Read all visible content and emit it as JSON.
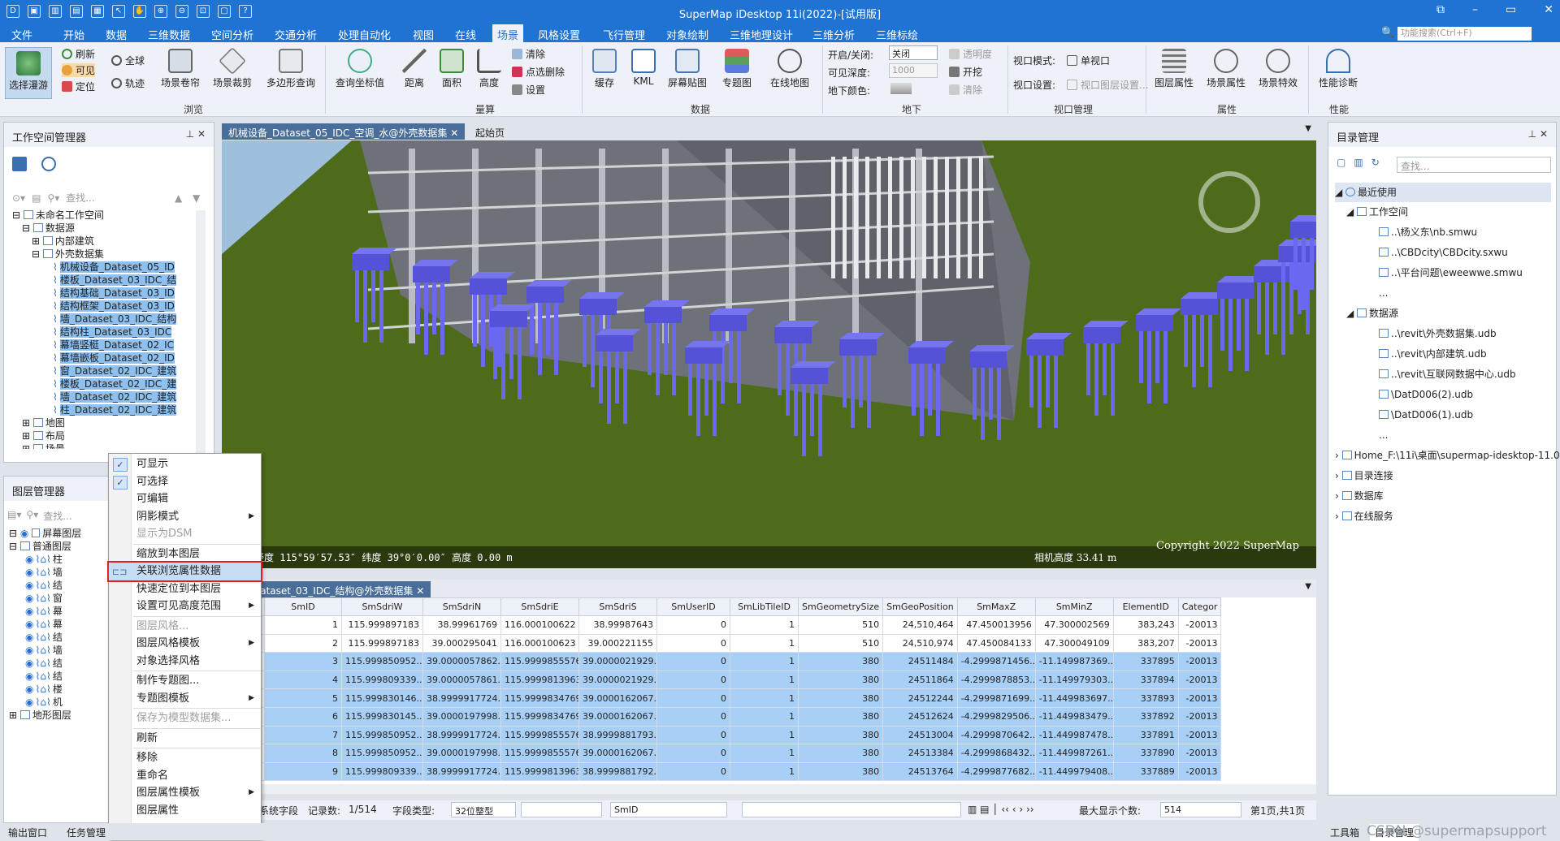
{
  "app": {
    "title": "SuperMap iDesktop 11i(2022)-[试用版]",
    "quick_access": [
      "D",
      "▣",
      "▥",
      "▤",
      "▦",
      "↖",
      "✋",
      "⊕",
      "⊖",
      "⊡",
      "▢",
      "?"
    ],
    "window_controls": [
      "⧉",
      "–",
      "▭",
      "✕"
    ],
    "watermark": "CSDN @supermapsupport"
  },
  "menu": {
    "items": [
      "文件",
      "开始",
      "数据",
      "三维数据",
      "空间分析",
      "交通分析",
      "处理自动化",
      "视图",
      "在线",
      "场景",
      "风格设置",
      "飞行管理",
      "对象绘制",
      "三维地理设计",
      "三维分析",
      "三维标绘"
    ],
    "selected": "场景",
    "search_placeholder": "功能搜索(Ctrl+F)",
    "search_icon": "🔍"
  },
  "ribbon": {
    "browse": {
      "big": "选择漫游",
      "small": [
        "刷新",
        "可见",
        "定位"
      ],
      "small2": [
        "全球",
        "轨迹"
      ],
      "buttons": [
        "场景卷帘",
        "场景裁剪",
        "多边形查询"
      ],
      "group": "浏览"
    },
    "measure": {
      "buttons": [
        "查询坐标值",
        "距离",
        "面积",
        "高度"
      ],
      "small": [
        "清除",
        "点选删除",
        "设置"
      ],
      "group": "量算"
    },
    "data": {
      "buttons": [
        "缓存",
        "KML",
        "屏幕贴图",
        "专题图",
        "在线地图"
      ],
      "group": "数据"
    },
    "underground": {
      "labels": [
        "开启/关闭:",
        "可见深度:",
        "地下颜色:"
      ],
      "toggle_value": "关闭",
      "depth_value": "1000",
      "small": [
        "透明度",
        "开挖",
        "清除"
      ],
      "group": "地下"
    },
    "viewport": {
      "labels": [
        "视口模式:",
        "视口设置:"
      ],
      "mode_value": "单视口",
      "settings_value": "视口图层设置...",
      "group": "视口管理"
    },
    "attr": {
      "buttons": [
        "图层属性",
        "场景属性",
        "场景特效"
      ],
      "group": "属性"
    },
    "perf": {
      "buttons": [
        "性能诊断"
      ],
      "group": "性能"
    }
  },
  "workspace": {
    "title": "工作空间管理器",
    "search_placeholder": "查找...",
    "root": "未命名工作空间",
    "datasource_node": "数据源",
    "ds_children": [
      "内部建筑",
      "外壳数据集"
    ],
    "datasets": [
      "机械设备_Dataset_05_ID",
      "楼板_Dataset_03_IDC_结",
      "结构基础_Dataset_03_ID",
      "结构框架_Dataset_03_ID",
      "墙_Dataset_03_IDC_结构",
      "结构柱_Dataset_03_IDC",
      "幕墙竖梃_Dataset_02_IC",
      "幕墙嵌板_Dataset_02_ID",
      "窗_Dataset_02_IDC_建筑",
      "楼板_Dataset_02_IDC_建",
      "墙_Dataset_02_IDC_建筑",
      "柱_Dataset_02_IDC_建筑"
    ],
    "others": [
      "地图",
      "布局",
      "场景"
    ]
  },
  "layers": {
    "title": "图层管理器",
    "search_placeholder": "查找...",
    "nodes": [
      "屏幕图层",
      "普通图层",
      "地形图层"
    ],
    "layer_rows": [
      "柱",
      "墙",
      "结",
      "窗",
      "幕",
      "幕",
      "结",
      "墙",
      "结",
      "结",
      "楼",
      "机"
    ]
  },
  "context_menu": {
    "items": [
      {
        "label": "可显示",
        "checked": true
      },
      {
        "label": "可选择",
        "checked": true
      },
      {
        "label": "可编辑"
      },
      {
        "label": "阴影模式",
        "sub": true
      },
      {
        "label": "显示为DSM",
        "disabled": true
      },
      {
        "divider": true
      },
      {
        "label": "缩放到本图层"
      },
      {
        "label": "关联浏览属性数据",
        "highlight": true
      },
      {
        "label": "快速定位到本图层"
      },
      {
        "label": "设置可见高度范围",
        "sub": true
      },
      {
        "divider": true
      },
      {
        "label": "图层风格...",
        "disabled": true
      },
      {
        "label": "图层风格模板",
        "sub": true
      },
      {
        "label": "对象选择风格"
      },
      {
        "divider": true
      },
      {
        "label": "制作专题图..."
      },
      {
        "label": "专题图模板",
        "sub": true
      },
      {
        "divider": true
      },
      {
        "label": "保存为模型数据集...",
        "disabled": true
      },
      {
        "divider": true
      },
      {
        "label": "刷新"
      },
      {
        "divider": true
      },
      {
        "label": "移除"
      },
      {
        "label": "重命名"
      },
      {
        "label": "图层属性模板",
        "sub": true
      },
      {
        "label": "图层属性"
      }
    ]
  },
  "scene": {
    "tabs": [
      "机械设备_Dataset_05_IDC_空调_水@外壳数据集",
      "起始页"
    ],
    "copyright": "Copyright 2022 SuperMap",
    "coord_text": "经度 115°59′57.53″  纬度 39°0′0.00″  高度 0.00 m",
    "camera_text": "相机高度 33.41 m"
  },
  "grid": {
    "tab": "结构_Dataset_03_IDC_结构@外壳数据集",
    "columns": [
      "",
      "SmID",
      "SmSdriW",
      "SmSdriN",
      "SmSdriE",
      "SmSdriS",
      "SmUserID",
      "SmLibTileID",
      "SmGeometrySize",
      "SmGeoPosition",
      "SmMaxZ",
      "SmMinZ",
      "ElementID",
      "Categor"
    ],
    "rows": [
      [
        "1",
        "1",
        "115.999897183",
        "38.99961769",
        "116.000100622",
        "38.99987643",
        "0",
        "1",
        "510",
        "24,510,464",
        "47.450013956",
        "47.300002569",
        "383,243",
        "-20013"
      ],
      [
        "2",
        "2",
        "115.999897183",
        "39.000295041",
        "116.000100623",
        "39.000221155",
        "0",
        "1",
        "510",
        "24,510,974",
        "47.450084133",
        "47.300049109",
        "383,207",
        "-20013"
      ],
      [
        "3",
        "3",
        "115.999850952...",
        "39.0000057862...",
        "115.9999855576...",
        "39.0000021929...",
        "0",
        "1",
        "380",
        "24511484",
        "-4.2999871456...",
        "-11.149987369...",
        "337895",
        "-20013"
      ],
      [
        "4",
        "4",
        "115.999809339...",
        "39.0000057861...",
        "115.9999813963...",
        "39.0000021929...",
        "0",
        "1",
        "380",
        "24511864",
        "-4.2999878853...",
        "-11.149979303...",
        "337894",
        "-20013"
      ],
      [
        "5",
        "5",
        "115.999830146...",
        "38.9999917724...",
        "115.9999834769...",
        "39.0000162067...",
        "0",
        "1",
        "380",
        "24512244",
        "-4.2999871699...",
        "-11.449983697...",
        "337893",
        "-20013"
      ],
      [
        "6",
        "6",
        "115.999830145...",
        "39.0000197998...",
        "115.9999834769...",
        "39.0000162067...",
        "0",
        "1",
        "380",
        "24512624",
        "-4.2999829506...",
        "-11.449983479...",
        "337892",
        "-20013"
      ],
      [
        "7",
        "7",
        "115.999850952...",
        "38.9999917724...",
        "115.9999855576...",
        "38.9999881793...",
        "0",
        "1",
        "380",
        "24513004",
        "-4.2999870642...",
        "-11.449987478...",
        "337891",
        "-20013"
      ],
      [
        "8",
        "8",
        "115.999850952...",
        "39.0000197998...",
        "115.9999855576...",
        "39.0000162067...",
        "0",
        "1",
        "380",
        "24513384",
        "-4.2999868432...",
        "-11.449987261...",
        "337890",
        "-20013"
      ],
      [
        "9",
        "9",
        "115.999809339...",
        "38.9999917724...",
        "115.9999813963...",
        "38.9999881792...",
        "0",
        "1",
        "380",
        "24513764",
        "-4.2999877682...",
        "-11.449979408...",
        "337889",
        "-20013"
      ]
    ]
  },
  "status": {
    "system_field": "系统字段",
    "records_label": "记录数:",
    "records_value": "1/514",
    "type_label": "字段类型:",
    "type_value": "32位整型",
    "field_value": "SmID",
    "max_label": "最大显示个数:",
    "max_value": "514",
    "page": "第1页,共1页"
  },
  "catalog": {
    "title": "目录管理",
    "search_placeholder": "查找...",
    "recent": "最近使用",
    "workspace": "工作空间",
    "ws_items": [
      "..\\杨义东\\nb.smwu",
      "..\\CBDcity\\CBDcity.sxwu",
      "..\\平台问题\\eweewwe.smwu",
      "..."
    ],
    "datasource": "数据源",
    "ds_items": [
      "..\\revit\\外壳数据集.udb",
      "..\\revit\\内部建筑.udb",
      "..\\revit\\互联网数据中心.udb",
      "\\DatD006(2).udb",
      "\\DatD006(1).udb",
      "..."
    ],
    "others": [
      "Home_F:\\11i\\桌面\\supermap-idesktop-11.0....",
      "目录连接",
      "数据库",
      "在线服务"
    ]
  },
  "bottom": {
    "left_tabs": [
      "输出窗口",
      "任务管理"
    ],
    "right_tabs": [
      "工具箱",
      "目录管理"
    ]
  },
  "colors": {
    "title": "#1e73d3",
    "sky": "#9fc0dd",
    "ground": "#4d6b1a",
    "pillar": "#6a68f0",
    "cap": "#5552d8",
    "building": "#6e7178",
    "selection": "#a8cff5",
    "highlight_box": "#e02020"
  }
}
